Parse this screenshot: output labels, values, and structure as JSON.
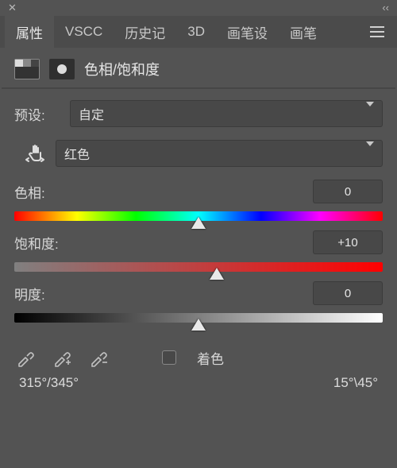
{
  "tabs": {
    "items": [
      "属性",
      "VSCC",
      "历史记",
      "3D",
      "画笔设",
      "画笔"
    ],
    "activeIndex": 0
  },
  "header": {
    "title": "色相/饱和度"
  },
  "preset": {
    "label": "预设:",
    "value": "自定"
  },
  "channel": {
    "value": "红色"
  },
  "hue": {
    "label": "色相:",
    "value": "0",
    "thumbPercent": 50
  },
  "saturation": {
    "label": "饱和度:",
    "value": "+10",
    "thumbPercent": 55
  },
  "lightness": {
    "label": "明度:",
    "value": "0",
    "thumbPercent": 50
  },
  "colorize": {
    "label": "着色",
    "checked": false
  },
  "range": {
    "left": "315°/345°",
    "right": "15°\\45°"
  },
  "icons": {
    "close": "close-icon",
    "collapse": "collapse-icon",
    "menu": "menu-icon",
    "adj": "adjustment-layer-icon",
    "mask": "layer-mask-icon",
    "hand": "targeted-adjustment-icon",
    "eyedrop": "eyedropper-icon",
    "eyedropPlus": "eyedropper-plus-icon",
    "eyedropMinus": "eyedropper-minus-icon"
  }
}
